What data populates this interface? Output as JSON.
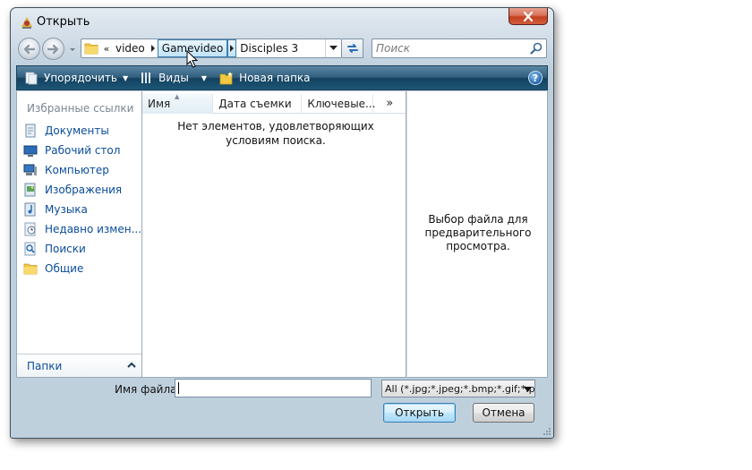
{
  "window": {
    "title": "Открыть",
    "colors": {
      "toolbar": "#1d5677",
      "link": "#0a4c9a",
      "close": "#c3401f"
    }
  },
  "address": {
    "overflow": "«",
    "crumbs": [
      "video",
      "Gamevideo",
      "Disciples 3"
    ]
  },
  "search": {
    "placeholder": "Поиск"
  },
  "toolbar": {
    "organize": "Упорядочить",
    "views": "Виды",
    "new_folder": "Новая папка",
    "help": "?"
  },
  "sidebar": {
    "header": "Избранные ссылки",
    "items": [
      {
        "label": "Документы",
        "icon": "documents-icon"
      },
      {
        "label": "Рабочий стол",
        "icon": "desktop-icon"
      },
      {
        "label": "Компьютер",
        "icon": "computer-icon"
      },
      {
        "label": "Изображения",
        "icon": "pictures-icon"
      },
      {
        "label": "Музыка",
        "icon": "music-icon"
      },
      {
        "label": "Недавно измен...",
        "icon": "recent-icon"
      },
      {
        "label": "Поиски",
        "icon": "searches-icon"
      },
      {
        "label": "Общие",
        "icon": "public-folder-icon"
      }
    ],
    "folders_label": "Папки"
  },
  "filelist": {
    "columns": [
      "Имя",
      "Дата съемки",
      "Ключевые..."
    ],
    "more": "»",
    "empty_message": "Нет элементов, удовлетворяющих условиям поиска."
  },
  "preview": {
    "message": "Выбор файла для предварительного просмотра."
  },
  "footer": {
    "filename_label": "Имя файла:",
    "filename_value": "",
    "filter": "All (*.jpg;*.jpeg;*.bmp;*.gif;*.png",
    "open": "Открыть",
    "cancel": "Отмена"
  }
}
